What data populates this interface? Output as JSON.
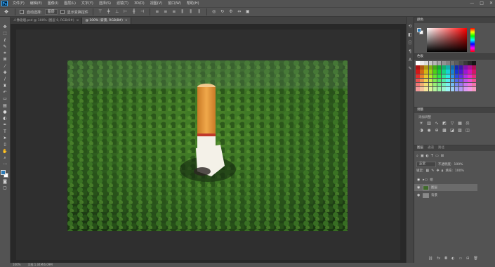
{
  "app": {
    "logo_text": "Ps"
  },
  "menu": {
    "items": [
      "文件(F)",
      "编辑(E)",
      "图像(I)",
      "图层(L)",
      "文字(Y)",
      "选择(S)",
      "滤镜(T)",
      "3D(D)",
      "视图(V)",
      "窗口(W)",
      "帮助(H)"
    ]
  },
  "window_controls": {
    "minimize": "—",
    "maximize": "□",
    "close": "✕"
  },
  "options_bar": {
    "auto_select_label": "自动选择:",
    "auto_select_value": "图层",
    "show_transform_label": "显示变换控件"
  },
  "tabs": [
    {
      "label": "人像吸烟.psd @ 100% (图层 0, RGB/8#)",
      "close": "×"
    },
    {
      "label": "@ 100% (背景, RGB/8#)",
      "close": "×"
    }
  ],
  "status": {
    "zoom": "100%",
    "doc_size": "文档:1.04M/6.09M"
  },
  "panels": {
    "color": {
      "tabs": [
        "颜色",
        "色板"
      ]
    },
    "swatches": {
      "title": "色板"
    },
    "adjustments": {
      "tabs": [
        "调整",
        "样式"
      ],
      "subtitle": "添加调整"
    },
    "layers": {
      "tabs": [
        "图层",
        "通道",
        "路径"
      ],
      "blend_mode": "正常",
      "opacity_label": "不透明度:",
      "opacity_value": "100%",
      "lock_label": "锁定:",
      "fill_label": "填充:",
      "fill_value": "100%",
      "items": [
        {
          "name": "组"
        },
        {
          "name": "图层"
        },
        {
          "name": "背景"
        }
      ]
    }
  },
  "colors": {
    "foreground": "#2c7ab5",
    "background": "#ffffff",
    "forest": "#2f5e1f",
    "cigarette_filter": "#e79a3a",
    "cigarette_paper": "#f4f1e8"
  }
}
